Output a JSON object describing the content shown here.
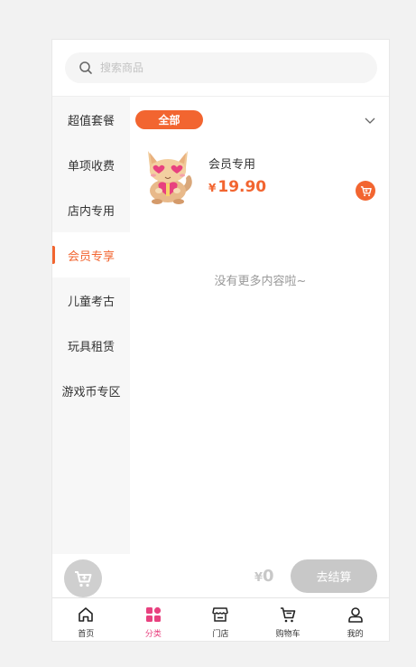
{
  "search": {
    "placeholder": "搜索商品"
  },
  "sidebar": {
    "items": [
      {
        "label": "超值套餐"
      },
      {
        "label": "单项收费"
      },
      {
        "label": "店内专用"
      },
      {
        "label": "会员专享"
      },
      {
        "label": "儿童考古"
      },
      {
        "label": "玩具租赁"
      },
      {
        "label": "游戏币专区"
      }
    ],
    "active_index": 3
  },
  "filter": {
    "label": "全部"
  },
  "products": [
    {
      "name": "会员专用",
      "currency": "¥",
      "price": "19.90",
      "image": "cartoon-cat-with-gift"
    }
  ],
  "list_end_text": "没有更多内容啦~",
  "cart": {
    "currency": "¥",
    "total": "0",
    "checkout_label": "去结算"
  },
  "tabs": [
    {
      "label": "首页",
      "icon": "home-icon"
    },
    {
      "label": "分类",
      "icon": "category-icon"
    },
    {
      "label": "门店",
      "icon": "store-icon"
    },
    {
      "label": "购物车",
      "icon": "cart-icon"
    },
    {
      "label": "我的",
      "icon": "user-icon"
    }
  ],
  "colors": {
    "accent": "#f26530",
    "tab_active": "#e8417f",
    "disabled": "#c8c8c8"
  }
}
